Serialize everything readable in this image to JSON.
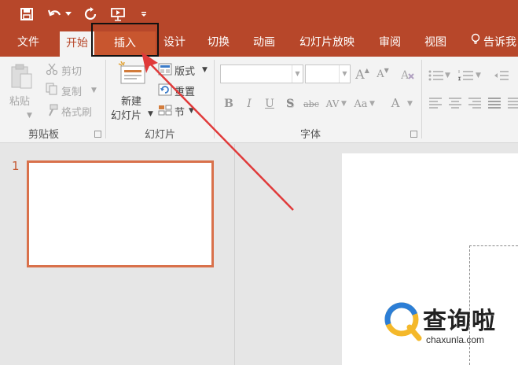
{
  "tabs": [
    {
      "label": "文件"
    },
    {
      "label": "开始"
    },
    {
      "label": "插入"
    },
    {
      "label": "设计"
    },
    {
      "label": "切换"
    },
    {
      "label": "动画"
    },
    {
      "label": "幻灯片放映"
    },
    {
      "label": "审阅"
    },
    {
      "label": "视图"
    },
    {
      "label": "告诉我"
    }
  ],
  "clipboard": {
    "paste": "粘贴",
    "cut": "剪切",
    "copy": "复制",
    "format_painter": "格式刷",
    "group_label": "剪贴板"
  },
  "slides_group": {
    "new_slide_line1": "新建",
    "new_slide_line2": "幻灯片",
    "layout": "版式",
    "reset": "重置",
    "section": "节",
    "group_label": "幻灯片"
  },
  "font_group": {
    "bold": "B",
    "italic": "I",
    "underline": "U",
    "shadow": "S",
    "strike": "abc",
    "spacing": "AV",
    "change_case": "Aa",
    "font_color": "A",
    "grow": "A",
    "shrink": "A",
    "group_label": "字体"
  },
  "thumbnail": {
    "number": "1"
  },
  "watermark": {
    "brand": "查询啦",
    "url": "chaxunla.com"
  },
  "colors": {
    "accent": "#b7472a",
    "arrow": "#e03a3a"
  }
}
